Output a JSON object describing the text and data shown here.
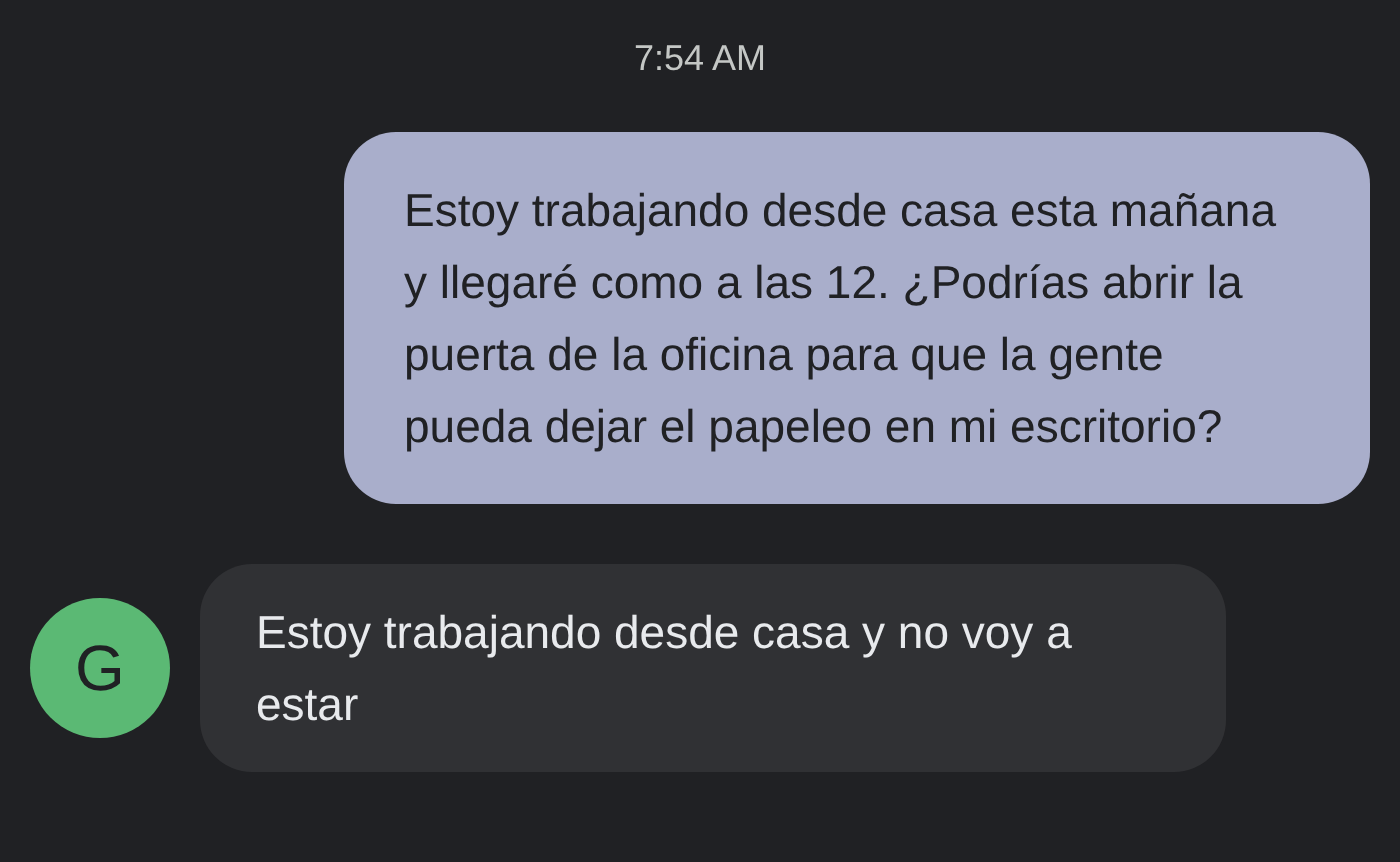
{
  "timestamp": "7:54 AM",
  "messages": [
    {
      "kind": "outgoing",
      "text": "Estoy trabajando desde casa esta mañana y llegaré como a las 12. ¿Podrías abrir la puerta de la oficina para que la gente pueda dejar el papeleo en mi escritorio?"
    },
    {
      "kind": "incoming",
      "avatar": "G",
      "text": "Estoy trabajando desde casa y no voy a estar"
    }
  ]
}
